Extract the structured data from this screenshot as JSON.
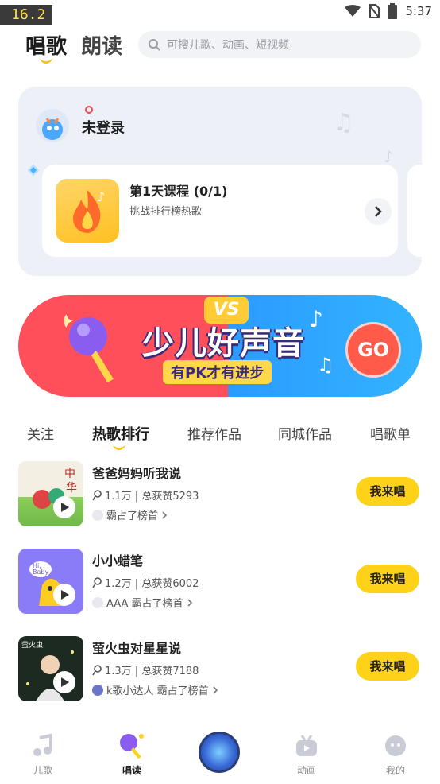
{
  "status_bar": {
    "fps": "16.2",
    "time": "5:37",
    "icons": [
      "wifi-icon",
      "no-sim-icon",
      "battery-icon"
    ]
  },
  "header": {
    "tab_active": "唱歌",
    "tab_inactive": "朗读",
    "search_placeholder": "可搜儿歌、动画、短视频"
  },
  "login_card": {
    "login_label": "未登录",
    "course": {
      "title": "第1天课程 (0/1)",
      "subtitle": "挑战排行榜热歌"
    }
  },
  "banner": {
    "vs": "VS",
    "title": "少儿好声音",
    "subtitle": "有PK才有进步",
    "go": "GO"
  },
  "tabs": [
    {
      "label": "关注"
    },
    {
      "label": "热歌排行"
    },
    {
      "label": "推荐作品"
    },
    {
      "label": "同城作品"
    },
    {
      "label": "唱歌单"
    }
  ],
  "songs": [
    {
      "title": "爸爸妈妈听我说",
      "meta": "1.1万 | 总获赞5293",
      "top": "霸占了榜首",
      "button": "我来唱"
    },
    {
      "title": "小小蜡笔",
      "meta": "1.2万 | 总获赞6002",
      "top": "AAA 霸占了榜首",
      "button": "我来唱"
    },
    {
      "title": "萤火虫对星星说",
      "meta": "1.3万 | 总获赞7188",
      "top": "k歌小达人 霸占了榜首",
      "button": "我来唱"
    }
  ],
  "bottom_nav": [
    {
      "label": "儿歌"
    },
    {
      "label": "唱读"
    },
    {
      "label": "动画"
    },
    {
      "label": "我的"
    }
  ],
  "colors": {
    "accent_yellow": "#ffd21a",
    "banner_red": "#ff4f5a",
    "banner_blue": "#2b9bff"
  }
}
